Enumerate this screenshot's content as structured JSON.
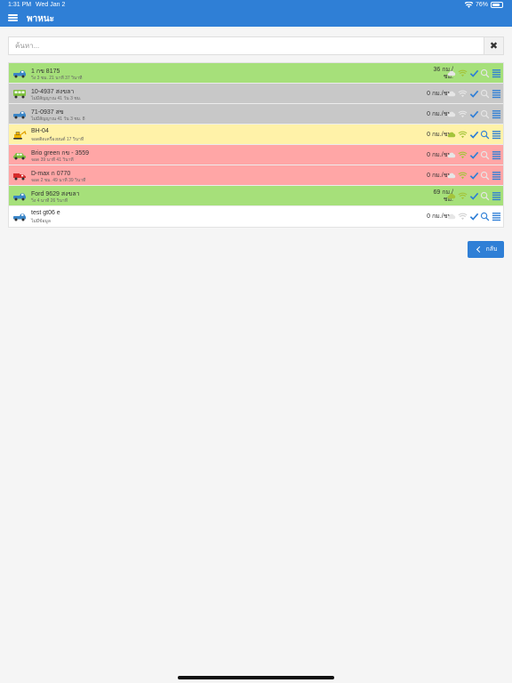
{
  "status_bar": {
    "time": "1:31 PM",
    "date": "Wed Jan 2",
    "battery": "76%",
    "battery_level": 0.76
  },
  "nav": {
    "title": "พาหนะ"
  },
  "search": {
    "placeholder": "ค้นหา..."
  },
  "colors": {
    "primary": "#2f7fd6",
    "green": "#a6e07a",
    "gray": "#c8c8c8",
    "yellow": "#fff2a8",
    "red": "#ffa6a6",
    "white": "#ffffff"
  },
  "vehicles": [
    {
      "name": "1 กข 8175",
      "sub": "วิ่ง 3 ชม. 21 นาที 37 วินาที",
      "speed_line1": "36 กม./",
      "speed_line2": "ชม.",
      "row_color": "#a6e07a",
      "vehicle_icon": "pickup-truck-icon",
      "cloud": "none",
      "wifi": "green",
      "check": "blue",
      "search": "none"
    },
    {
      "name": "10-4937 สงขลา",
      "sub": "ไม่มีสัญญาณ 41 วัน 3 ชม.",
      "speed_line1": "0 กม./ชม.",
      "speed_line2": "",
      "row_color": "#c8c8c8",
      "vehicle_icon": "bus-icon",
      "cloud": "none",
      "wifi": "none",
      "check": "blue",
      "search": "none"
    },
    {
      "name": "71-0937 สข",
      "sub": "ไม่มีสัญญาณ 41 วัน 3 ชม. 8",
      "speed_line1": "0 กม./ชม.",
      "speed_line2": "",
      "row_color": "#c8c8c8",
      "vehicle_icon": "pickup-truck-icon",
      "cloud": "none",
      "wifi": "none",
      "check": "blue",
      "search": "none"
    },
    {
      "name": "BH-04",
      "sub": "จอดติดเครื่องยนต์ 17 วินาที",
      "speed_line1": "0 กม./ชม.",
      "speed_line2": "",
      "row_color": "#fff2a8",
      "vehicle_icon": "excavator-icon",
      "cloud": "green",
      "wifi": "green",
      "check": "blue",
      "search": "blue"
    },
    {
      "name": "Brio green กข - 3559",
      "sub": "จอด 39 นาที 41 วินาที",
      "speed_line1": "0 กม./ชม.",
      "speed_line2": "",
      "row_color": "#ffa6a6",
      "vehicle_icon": "car-icon",
      "cloud": "none",
      "wifi": "green",
      "check": "blue",
      "search": "none"
    },
    {
      "name": "D-max ก 0770",
      "sub": "จอด 2 ชม. 49 นาที 39 วินาที",
      "speed_line1": "0 กม./ชม.",
      "speed_line2": "",
      "row_color": "#ffa6a6",
      "vehicle_icon": "red-truck-icon",
      "cloud": "none",
      "wifi": "green",
      "check": "blue",
      "search": "none"
    },
    {
      "name": "Ford 9629 สงขลา",
      "sub": "วิ่ง 4 นาที 26 วินาที",
      "speed_line1": "69 กม./",
      "speed_line2": "ชม.",
      "row_color": "#a6e07a",
      "vehicle_icon": "pickup-truck-icon",
      "cloud": "green",
      "wifi": "green",
      "check": "blue",
      "search": "none"
    },
    {
      "name": "test gt06 e",
      "sub": "ไม่มีข้อมูล",
      "speed_line1": "0 กม./ชม.",
      "speed_line2": "",
      "row_color": "#ffffff",
      "vehicle_icon": "pickup-truck-icon",
      "cloud": "none",
      "wifi": "gray",
      "check": "blue",
      "search": "blue"
    }
  ],
  "back_button": {
    "label": "กลับ"
  }
}
